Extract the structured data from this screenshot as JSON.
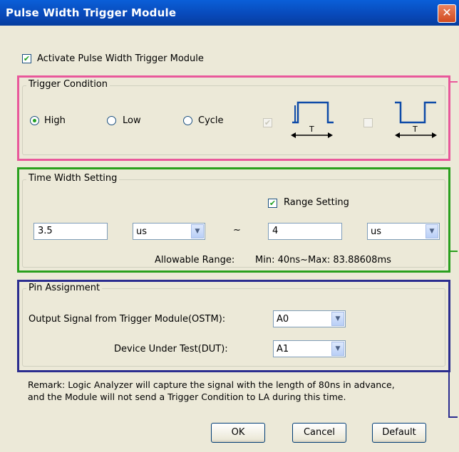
{
  "window": {
    "title": "Pulse Width Trigger Module",
    "close_glyph": "✕"
  },
  "activate": {
    "checked": true,
    "label": "Activate Pulse Width Trigger Module"
  },
  "trigger_condition": {
    "legend": "Trigger Condition",
    "options": [
      {
        "label": "High",
        "selected": true
      },
      {
        "label": "Low",
        "selected": false
      },
      {
        "label": "Cycle",
        "selected": false
      }
    ],
    "waveform_T": "T"
  },
  "time_width": {
    "legend": "Time Width Setting",
    "range_setting_label": "Range Setting",
    "min_value": "3.5",
    "min_unit": "us",
    "tilde": "~",
    "max_value": "4",
    "max_unit": "us",
    "allowable_label": "Allowable Range:",
    "allowable_value": "Min: 40ns~Max: 83.88608ms"
  },
  "pins": {
    "legend": "Pin Assignment",
    "ostm_label": "Output Signal from Trigger Module(OSTM):",
    "ostm_value": "A0",
    "dut_label": "Device Under Test(DUT):",
    "dut_value": "A1"
  },
  "remark": {
    "line1": "Remark: Logic Analyzer will capture the signal with the length of 80ns in advance,",
    "line2": "and the Module will not send a Trigger Condition to LA during this time."
  },
  "buttons": {
    "ok": "OK",
    "cancel": "Cancel",
    "default": "Default"
  },
  "colors": {
    "pink": "#e9589b",
    "green": "#2aa01e",
    "navy": "#2b2d8f",
    "title_bar": "#0a5fd8"
  }
}
